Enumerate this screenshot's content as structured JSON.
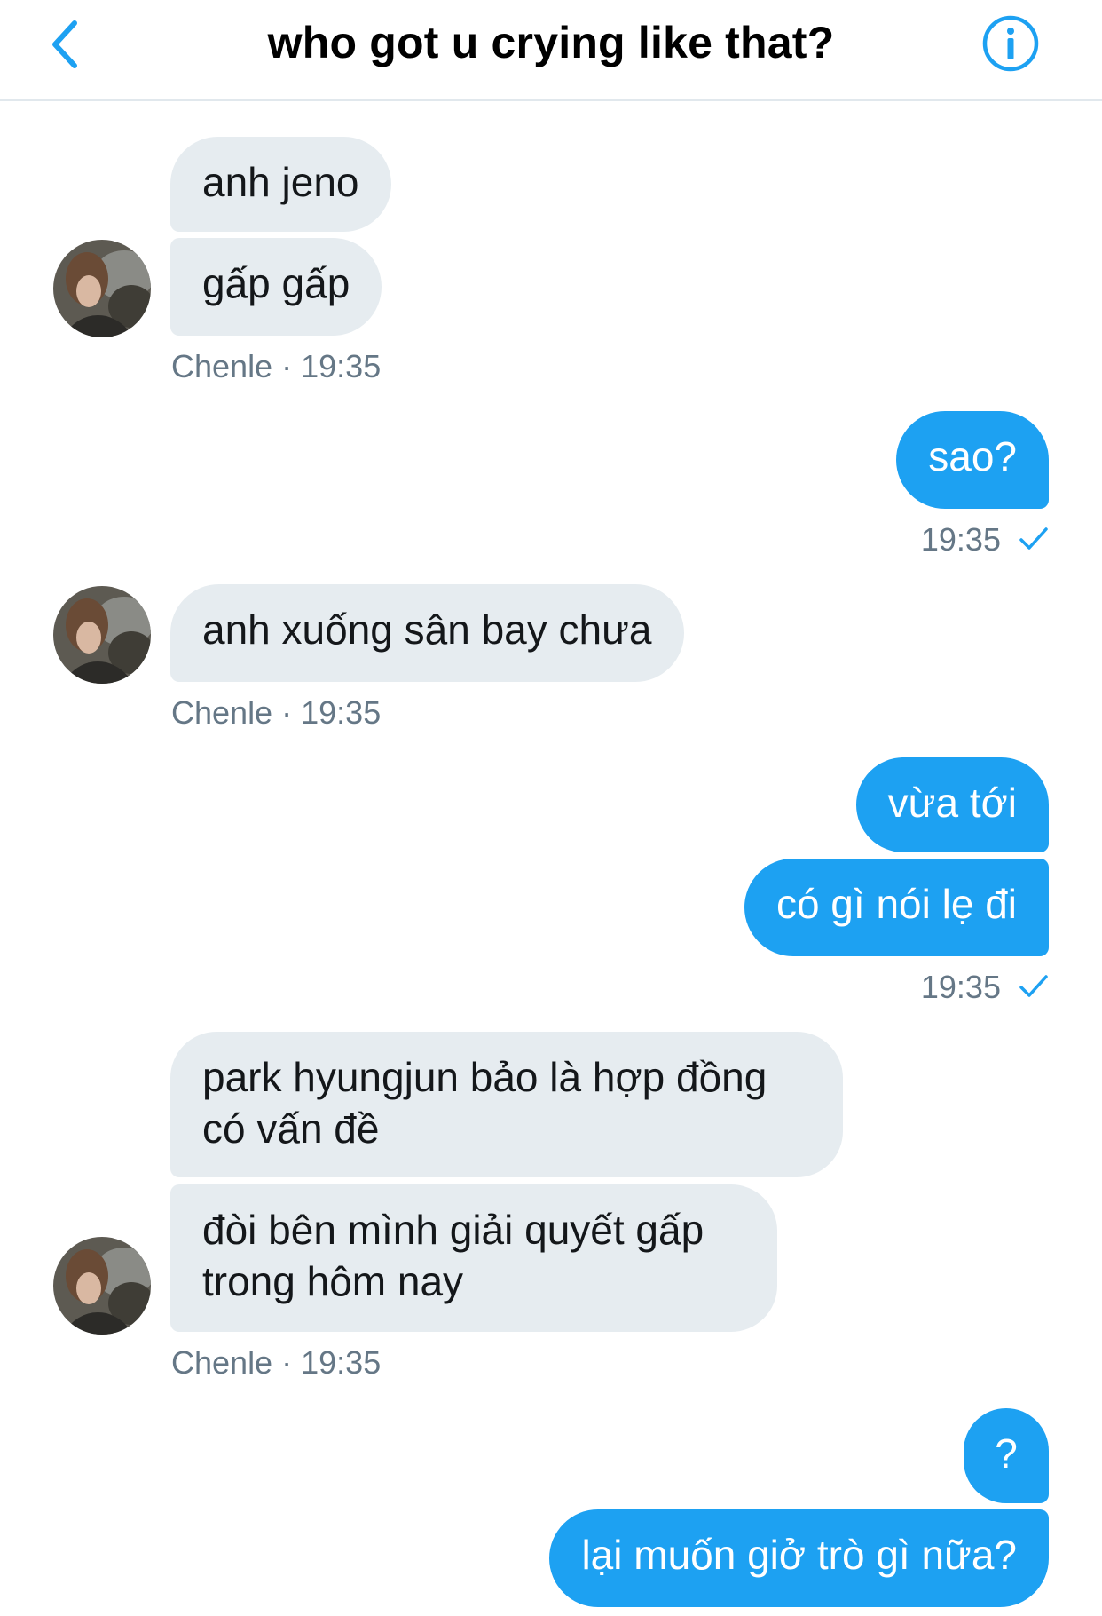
{
  "header": {
    "title": "who got u crying like that?"
  },
  "contact": {
    "name": "Chenle"
  },
  "messages": [
    {
      "side": "in",
      "lines": [
        "anh jeno",
        "gấp gấp"
      ],
      "sender": "Chenle",
      "time": "19:35"
    },
    {
      "side": "out",
      "lines": [
        "sao?"
      ],
      "time": "19:35",
      "status": "seen-check-icon"
    },
    {
      "side": "in",
      "lines": [
        "anh xuống sân bay chưa"
      ],
      "sender": "Chenle",
      "time": "19:35"
    },
    {
      "side": "out",
      "lines": [
        "vừa tới",
        "có gì nói lẹ đi"
      ],
      "time": "19:35",
      "status": "seen-check-icon"
    },
    {
      "side": "in",
      "lines": [
        "park hyungjun bảo là hợp đồng có vấn đề",
        "đòi bên mình giải quyết gấp trong hôm nay"
      ],
      "sender": "Chenle",
      "time": "19:35"
    },
    {
      "side": "out",
      "lines": [
        "?",
        "lại muốn giở trò gì nữa?"
      ]
    }
  ],
  "colors": {
    "accent": "#1da1f2",
    "incoming_bubble": "#e6ecf0",
    "meta_text": "#657786"
  },
  "icons": {
    "back": "chevron-left-icon",
    "info": "info-circle-icon",
    "read_receipt": "check-icon"
  },
  "meta_separator": "·"
}
